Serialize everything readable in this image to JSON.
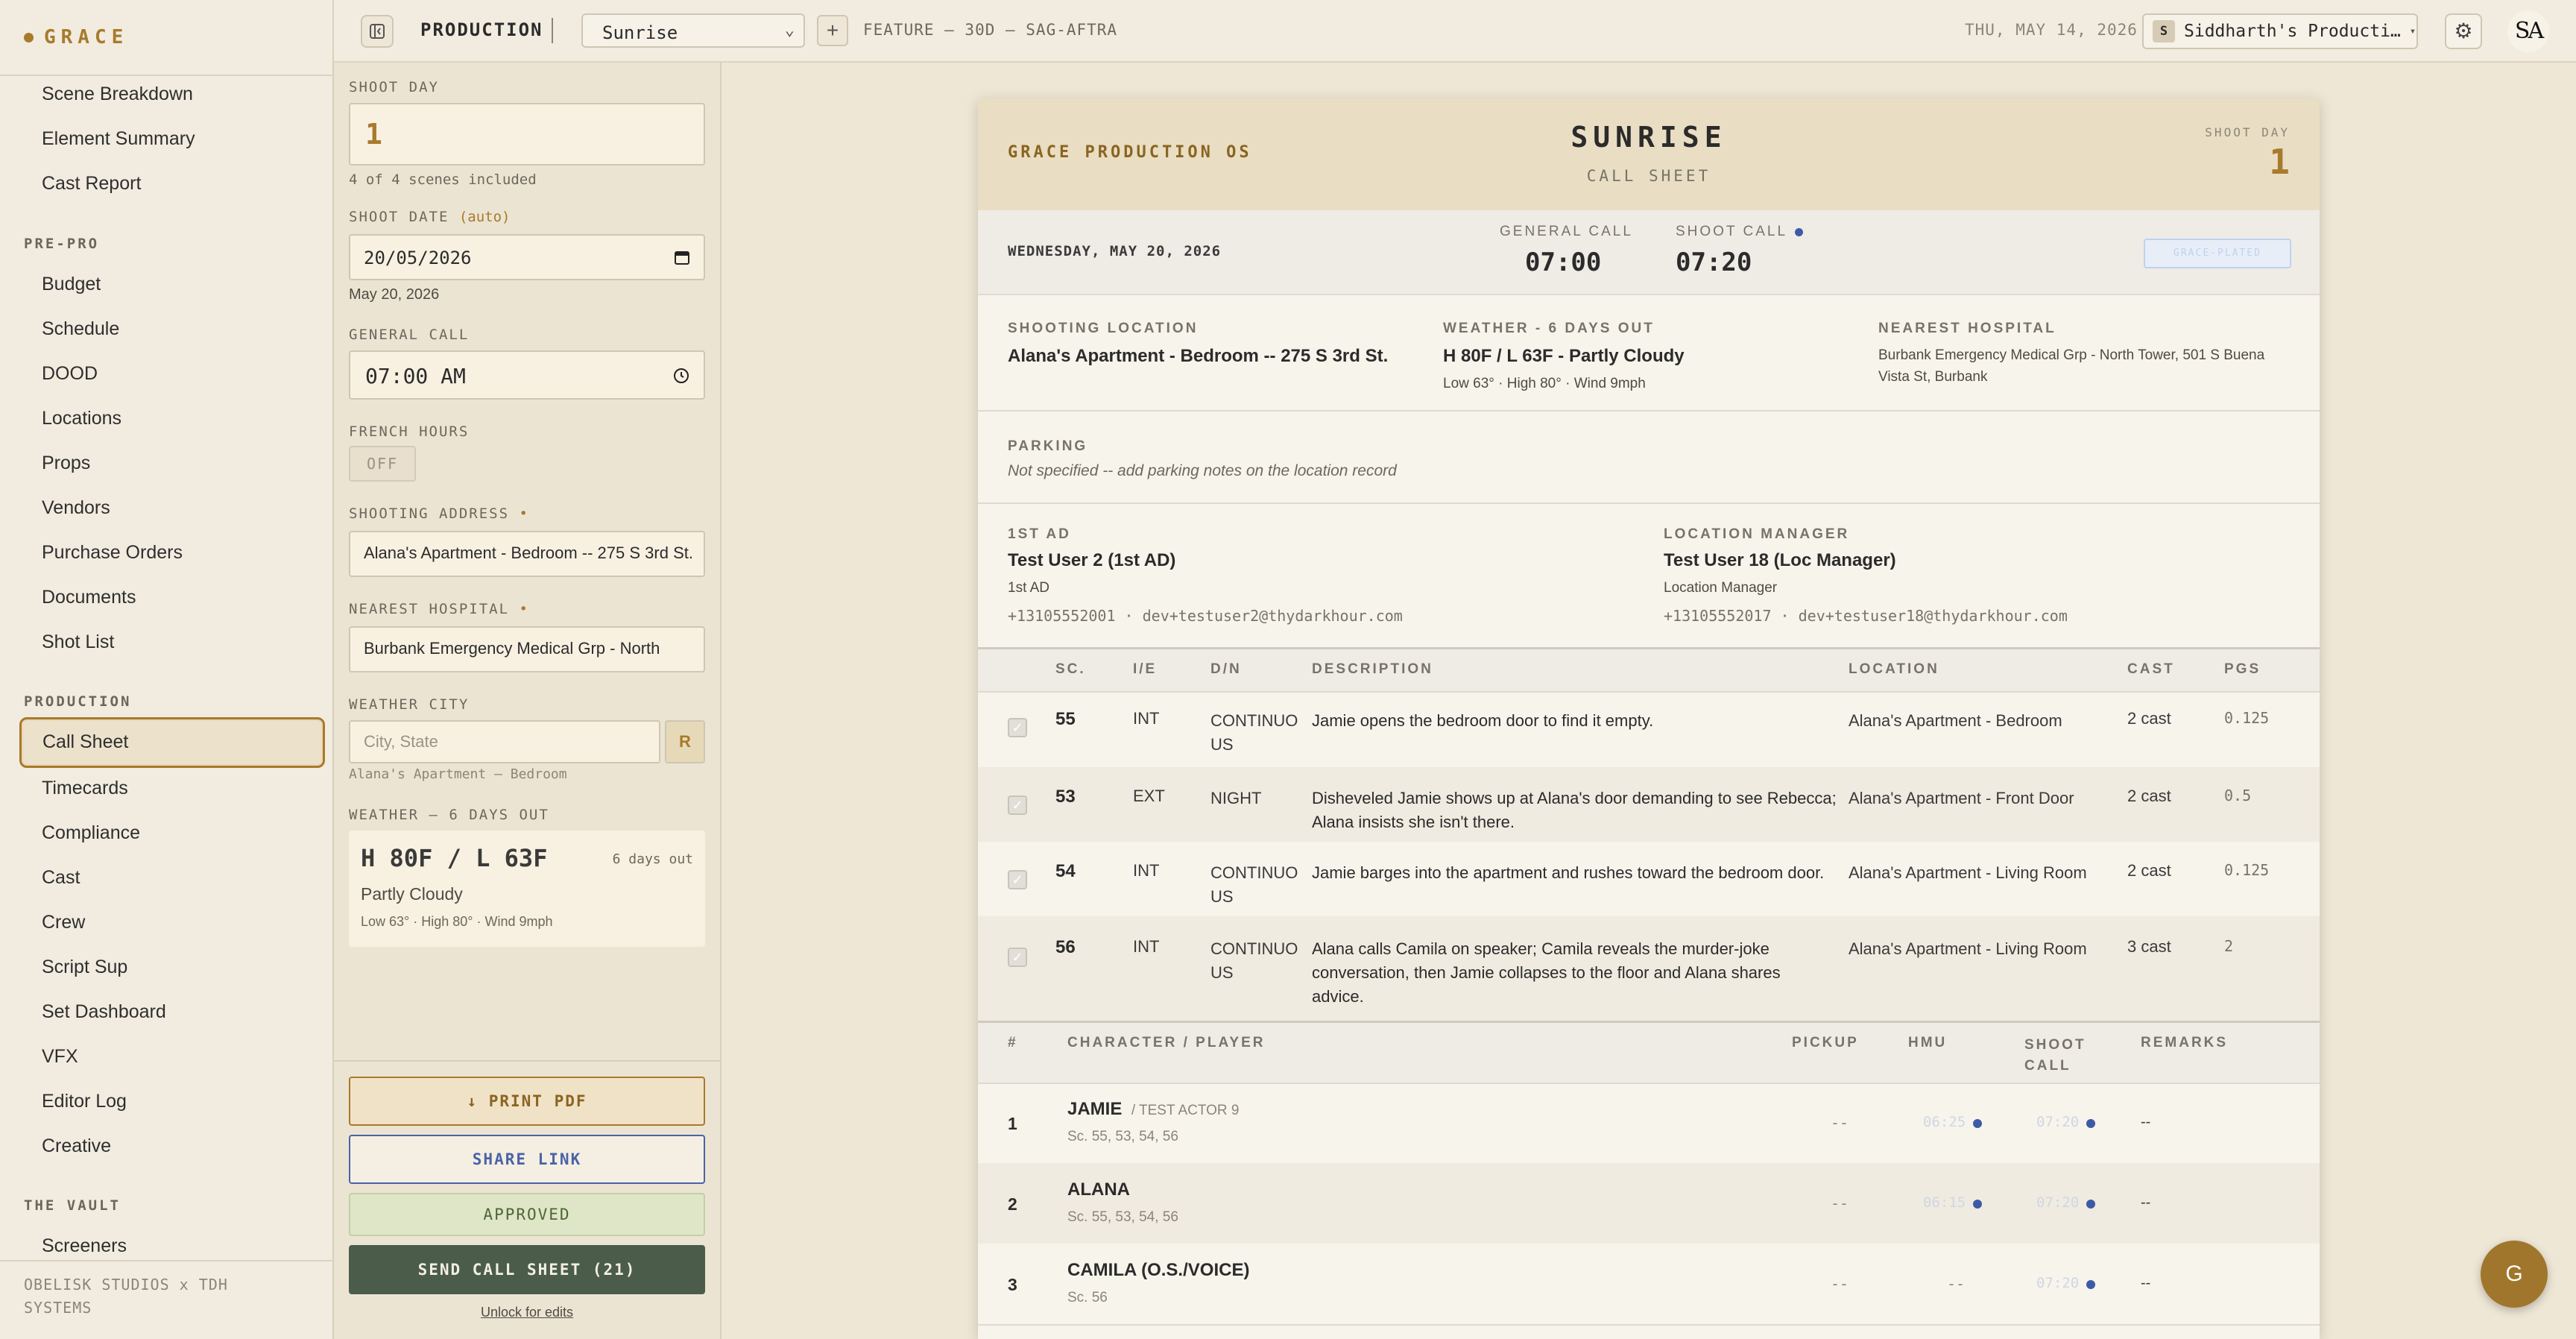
{
  "app": {
    "brand": "GRACE",
    "footer_line1": "OBELISK STUDIOS x TDH",
    "footer_line2": "SYSTEMS"
  },
  "sidebar": {
    "top_items": [
      "Scene Breakdown",
      "Element Summary",
      "Cast Report"
    ],
    "prepro_title": "PRE-PRO",
    "prepro_items": [
      "Budget",
      "Schedule",
      "DOOD",
      "Locations",
      "Props",
      "Vendors",
      "Purchase Orders",
      "Documents",
      "Shot List"
    ],
    "production_title": "PRODUCTION",
    "production_items": [
      "Call Sheet",
      "Timecards",
      "Compliance",
      "Cast",
      "Crew",
      "Script Sup",
      "Set Dashboard",
      "VFX",
      "Editor Log",
      "Creative"
    ],
    "vault_title": "THE VAULT",
    "vault_items": [
      "Screeners"
    ]
  },
  "topbar": {
    "mode": "PRODUCTION",
    "project": "Sunrise",
    "meta": "FEATURE — 30D — SAG-AFTRA",
    "date": "THU, MAY 14, 2026",
    "org_initial": "S",
    "org_name": "Siddharth's Producti…",
    "user_initials": "SA"
  },
  "form": {
    "shoot_day_label": "SHOOT DAY",
    "shoot_day_value": "1",
    "scenes_note": "4 of 4 scenes included",
    "shoot_date_label": "SHOOT DATE",
    "shoot_date_auto": "(auto)",
    "shoot_date_value": "20/05/2026",
    "shoot_date_note": "May 20, 2026",
    "general_call_label": "GENERAL CALL",
    "general_call_value": "07:00 AM",
    "french_hours_label": "FRENCH HOURS",
    "french_hours_value": "OFF",
    "shooting_address_label": "SHOOTING ADDRESS",
    "shooting_address_value": "Alana's Apartment - Bedroom -- 275 S 3rd St.",
    "nearest_hospital_label": "NEAREST HOSPITAL",
    "nearest_hospital_value": "Burbank Emergency Medical Grp - North",
    "weather_city_label": "WEATHER CITY",
    "weather_city_placeholder": "City, State",
    "weather_city_btn": "R",
    "weather_city_note": "Alana's Apartment — Bedroom",
    "weather_label": "WEATHER — 6 DAYS OUT",
    "weather_temp": "H 80F / L 63F",
    "weather_days": "6 days out",
    "weather_cond": "Partly Cloudy",
    "weather_detail": "Low 63° · High 80° · Wind 9mph",
    "btn_print": "↓ PRINT PDF",
    "btn_share": "SHARE LINK",
    "btn_approved": "APPROVED",
    "btn_send": "SEND CALL SHEET (21)",
    "unlock": "Unlock for edits"
  },
  "sheet": {
    "brand": "GRACE PRODUCTION OS",
    "title": "SUNRISE",
    "subtitle": "CALL SHEET",
    "shoot_day_cap": "SHOOT DAY",
    "shoot_day": "1",
    "date": "WEDNESDAY, MAY 20, 2026",
    "general_call_cap": "GENERAL CALL",
    "general_call": "07:00",
    "shoot_call_cap": "SHOOT CALL",
    "shoot_call": "07:20",
    "badge": "GRACE-PLATED",
    "location_cap": "SHOOTING LOCATION",
    "location": "Alana's Apartment - Bedroom -- 275 S 3rd St.",
    "weather_cap": "WEATHER - 6 DAYS OUT",
    "weather": "H 80F / L 63F - Partly Cloudy",
    "weather_detail": "Low 63° · High 80° · Wind 9mph",
    "hospital_cap": "NEAREST HOSPITAL",
    "hospital": "Burbank Emergency Medical Grp - North Tower, 501 S Buena Vista St, Burbank",
    "parking_cap": "PARKING",
    "parking": "Not specified -- add parking notes on the location record",
    "ad_cap": "1ST AD",
    "ad_name": "Test User 2 (1st AD)",
    "ad_role": "1st AD",
    "ad_phone": "+13105552001",
    "ad_email": "dev+testuser2@thydarkhour.com",
    "lm_cap": "LOCATION MANAGER",
    "lm_name": "Test User 18 (Loc Manager)",
    "lm_role": "Location Manager",
    "lm_phone": "+13105552017",
    "lm_email": "dev+testuser18@thydarkhour.com",
    "scene_headers": [
      "SC.",
      "I/E",
      "D/N",
      "DESCRIPTION",
      "LOCATION",
      "CAST",
      "PGS"
    ],
    "scenes": [
      {
        "sc": "55",
        "ie": "INT",
        "dn": "CONTINUO US",
        "desc": "Jamie opens the bedroom door to find it empty.",
        "loc": "Alana's Apartment - Bedroom",
        "cast": "2 cast",
        "pgs": "0.125"
      },
      {
        "sc": "53",
        "ie": "EXT",
        "dn": "NIGHT",
        "desc": "Disheveled Jamie shows up at Alana's door demanding to see Rebecca; Alana insists she isn't there.",
        "loc": "Alana's Apartment - Front Door",
        "cast": "2 cast",
        "pgs": "0.5"
      },
      {
        "sc": "54",
        "ie": "INT",
        "dn": "CONTINUO US",
        "desc": "Jamie barges into the apartment and rushes toward the bedroom door.",
        "loc": "Alana's Apartment - Living Room",
        "cast": "2 cast",
        "pgs": "0.125"
      },
      {
        "sc": "56",
        "ie": "INT",
        "dn": "CONTINUO US",
        "desc": "Alana calls Camila on speaker; Camila reveals the murder-joke conversation, then Jamie collapses to the floor and Alana shares advice.",
        "loc": "Alana's Apartment - Living Room",
        "cast": "3 cast",
        "pgs": "2"
      }
    ],
    "cast_headers": [
      "#",
      "CHARACTER / PLAYER",
      "PICKUP",
      "HMU",
      "SHOOT CALL",
      "REMARKS"
    ],
    "cast": [
      {
        "num": "1",
        "name": "JAMIE",
        "player": "/ TEST ACTOR 9",
        "scenes": "Sc. 55, 53, 54, 56",
        "pickup": "--",
        "hmu": "06:25",
        "call": "07:20",
        "remarks": "--"
      },
      {
        "num": "2",
        "name": "ALANA",
        "player": "",
        "scenes": "Sc. 55, 53, 54, 56",
        "pickup": "--",
        "hmu": "06:15",
        "call": "07:20",
        "remarks": "--"
      },
      {
        "num": "3",
        "name": "CAMILA (O.S./VOICE)",
        "player": "",
        "scenes": "Sc. 56",
        "pickup": "--",
        "hmu": "--",
        "call": "07:20",
        "remarks": "--"
      }
    ]
  },
  "fab": "G"
}
